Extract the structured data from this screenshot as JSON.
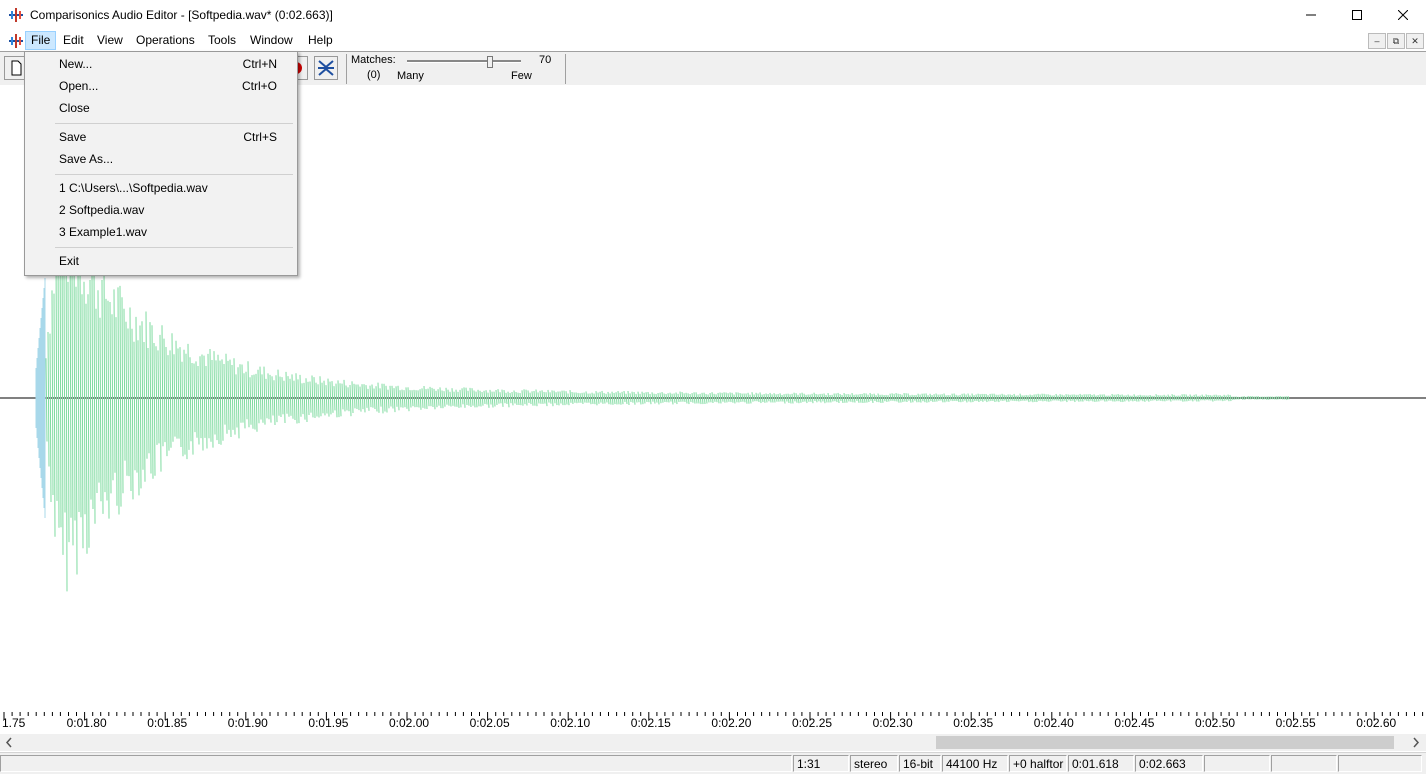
{
  "window": {
    "title": "Comparisonics Audio Editor - [Softpedia.wav* (0:02.663)]"
  },
  "menubar": {
    "items": [
      "File",
      "Edit",
      "View",
      "Operations",
      "Tools",
      "Window",
      "Help"
    ],
    "active": "File"
  },
  "file_menu": {
    "groups": [
      [
        {
          "label": "New...",
          "shortcut": "Ctrl+N"
        },
        {
          "label": "Open...",
          "shortcut": "Ctrl+O"
        },
        {
          "label": "Close",
          "shortcut": ""
        }
      ],
      [
        {
          "label": "Save",
          "shortcut": "Ctrl+S"
        },
        {
          "label": "Save As...",
          "shortcut": ""
        }
      ],
      [
        {
          "label": "1 C:\\Users\\...\\Softpedia.wav",
          "shortcut": ""
        },
        {
          "label": "2 Softpedia.wav",
          "shortcut": ""
        },
        {
          "label": "3 Example1.wav",
          "shortcut": ""
        }
      ],
      [
        {
          "label": "Exit",
          "shortcut": ""
        }
      ]
    ]
  },
  "matches": {
    "label": "Matches:",
    "value": "70",
    "count": "(0)",
    "many": "Many",
    "few": "Few",
    "level": 0.73
  },
  "timeline": {
    "labels": [
      "1.75",
      "0:01.80",
      "0:01.85",
      "0:01.90",
      "0:01.95",
      "0:02.00",
      "0:02.05",
      "0:02.10",
      "0:02.15",
      "0:02.20",
      "0:02.25",
      "0:02.30",
      "0:02.35",
      "0:02.40",
      "0:02.45",
      "0:02.50",
      "0:02.55",
      "0:02.60"
    ]
  },
  "status": {
    "ratio": "1:31",
    "channels": "stereo",
    "bits": "16-bit",
    "rate": "44100 Hz",
    "pitch": "+0 halftor",
    "position": "0:01.618",
    "length": "0:02.663"
  },
  "colors": {
    "wave": "#7fdba0",
    "wave_start": "#a8d8ea",
    "menu_highlight": "#cce8ff"
  }
}
